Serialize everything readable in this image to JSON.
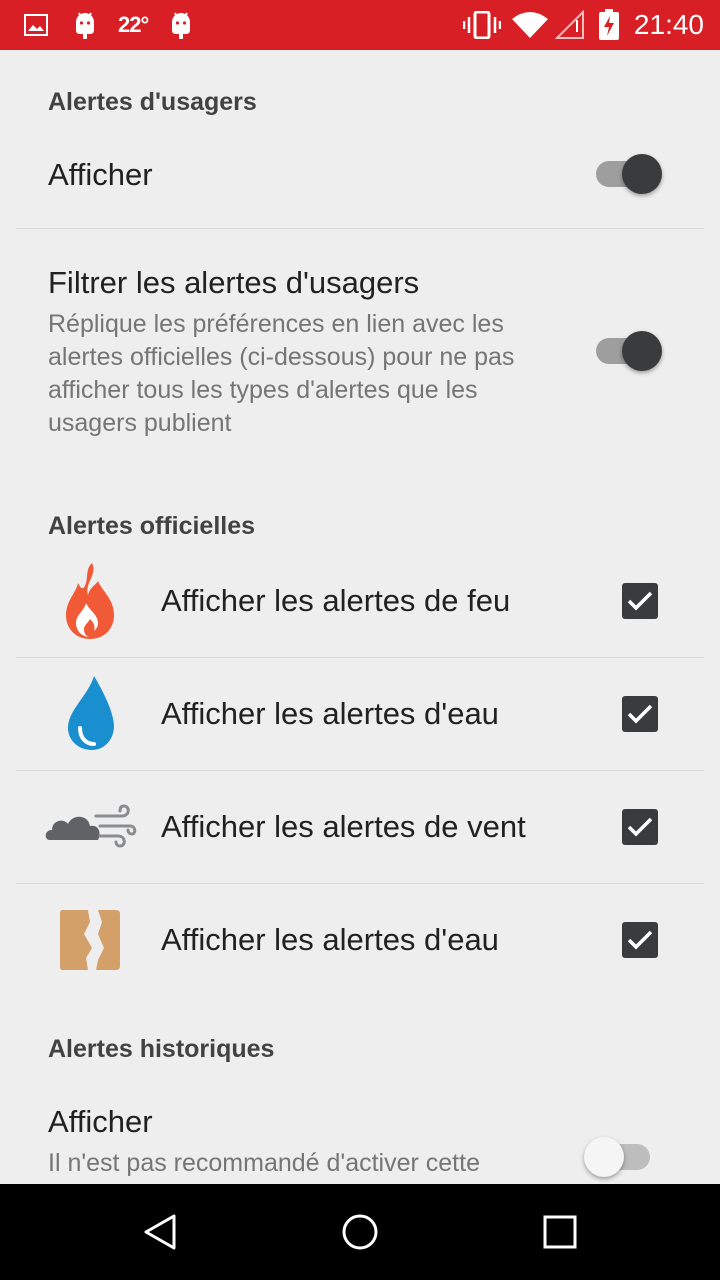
{
  "status_bar": {
    "temperature": "22°",
    "time": "21:40",
    "icons": [
      "image-icon",
      "android-icon",
      "android-icon",
      "vibrate-icon",
      "wifi-icon",
      "signal-icon",
      "battery-charging-icon"
    ]
  },
  "user_alerts": {
    "header": "Alertes d'usagers",
    "show": {
      "title": "Afficher",
      "enabled": true
    },
    "filter": {
      "title": "Filtrer les alertes d'usagers",
      "summary": "Réplique les préférences en lien avec les alertes officielles (ci-dessous) pour ne pas afficher tous les types d'alertes que les usagers publient",
      "enabled": true
    }
  },
  "official_alerts": {
    "header": "Alertes officielles",
    "items": [
      {
        "icon": "fire-icon",
        "label": "Afficher les alertes de feu",
        "checked": true
      },
      {
        "icon": "water-drop-icon",
        "label": "Afficher les alertes d'eau",
        "checked": true
      },
      {
        "icon": "wind-cloud-icon",
        "label": "Afficher les alertes de vent",
        "checked": true
      },
      {
        "icon": "earth-crack-icon",
        "label": "Afficher les alertes d'eau",
        "checked": true
      }
    ]
  },
  "historic_alerts": {
    "header": "Alertes historiques",
    "show": {
      "title": "Afficher",
      "summary": "Il n'est pas recommandé d'activer cette",
      "enabled": false
    }
  },
  "colors": {
    "status_bar": "#d81f26",
    "background": "#eeeeee",
    "accent_dark": "#3a3b3d",
    "fire": "#f05a36",
    "water": "#1a8fd0",
    "wind_cloud": "#606266",
    "earth": "#d4a06a"
  },
  "navigation": [
    "back-icon",
    "home-icon",
    "recents-icon"
  ]
}
